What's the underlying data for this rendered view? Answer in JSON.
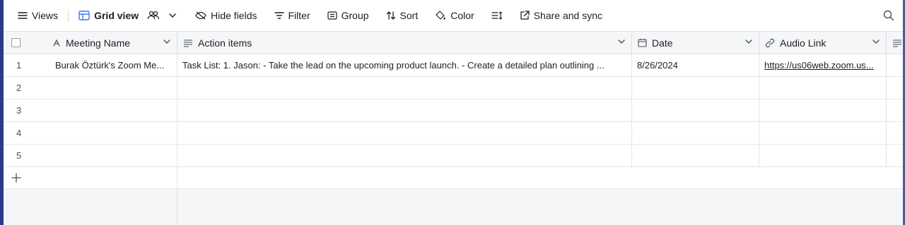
{
  "toolbar": {
    "views_label": "Views",
    "view_name": "Grid view",
    "hide_fields_label": "Hide fields",
    "filter_label": "Filter",
    "group_label": "Group",
    "sort_label": "Sort",
    "color_label": "Color",
    "share_label": "Share and sync"
  },
  "columns": {
    "meeting_name": "Meeting Name",
    "action_items": "Action items",
    "date": "Date",
    "audio_link": "Audio Link"
  },
  "rows": [
    {
      "num": "1",
      "meeting_name": "Burak Öztürk's Zoom Me...",
      "action_items": "Task List: 1. Jason: - Take the lead on the upcoming product launch. - Create a detailed plan outlining ...",
      "date": "8/26/2024",
      "audio_link": "https://us06web.zoom.us..."
    },
    {
      "num": "2",
      "meeting_name": "",
      "action_items": "",
      "date": "",
      "audio_link": ""
    },
    {
      "num": "3",
      "meeting_name": "",
      "action_items": "",
      "date": "",
      "audio_link": ""
    },
    {
      "num": "4",
      "meeting_name": "",
      "action_items": "",
      "date": "",
      "audio_link": ""
    },
    {
      "num": "5",
      "meeting_name": "",
      "action_items": "",
      "date": "",
      "audio_link": ""
    }
  ],
  "icons": {
    "views": "hamburger-icon",
    "grid": "grid-icon",
    "collaborators": "people-icon",
    "hide_fields": "eye-off-icon",
    "filter": "filter-icon",
    "group": "group-icon",
    "sort": "sort-icon",
    "color": "paint-bucket-icon",
    "row_height": "row-height-icon",
    "share": "external-link-icon",
    "search": "search-icon"
  },
  "colors": {
    "accent": "#2d7ff9",
    "frame": "#2a3a8c"
  }
}
